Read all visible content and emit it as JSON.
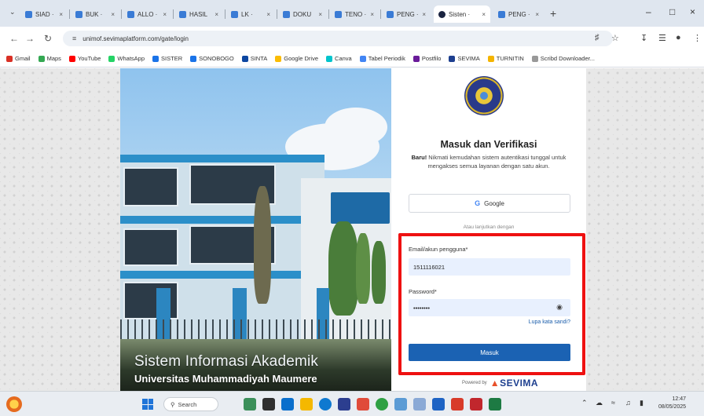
{
  "browser": {
    "tabs": [
      {
        "label": "SIAD ·",
        "active": false
      },
      {
        "label": "BUK ·",
        "active": false
      },
      {
        "label": "ALLO ·",
        "active": false
      },
      {
        "label": "HASIL",
        "active": false
      },
      {
        "label": "LK ·",
        "active": false
      },
      {
        "label": "DOKU",
        "active": false
      },
      {
        "label": "TENO ·",
        "active": false
      },
      {
        "label": "PENG ·",
        "active": false
      },
      {
        "label": "Sisten ·",
        "active": true
      },
      {
        "label": "PENG ·",
        "active": false
      }
    ],
    "url": "unimof.sevimaplatform.com/gate/login",
    "bookmarks": [
      {
        "label": "Gmail",
        "color": "#d93025"
      },
      {
        "label": "Maps",
        "color": "#34a853"
      },
      {
        "label": "YouTube",
        "color": "#ff0000"
      },
      {
        "label": "WhatsApp",
        "color": "#25d366"
      },
      {
        "label": "SISTER",
        "color": "#1a73e8"
      },
      {
        "label": "SONOBOGO",
        "color": "#1a73e8"
      },
      {
        "label": "SINTA",
        "color": "#0d47a1"
      },
      {
        "label": "Google Drive",
        "color": "#fbbc04"
      },
      {
        "label": "Canva",
        "color": "#00c4cc"
      },
      {
        "label": "Tabel Periodik",
        "color": "#4285f4"
      },
      {
        "label": "Postfilo",
        "color": "#6a1b9a"
      },
      {
        "label": "SEVIMA",
        "color": "#1d3f8f"
      },
      {
        "label": "TURNITIN",
        "color": "#f4b400"
      },
      {
        "label": "Scribd Downloader...",
        "color": "#999999"
      }
    ]
  },
  "hero": {
    "title_line1": "Sistem Informasi Akademik",
    "title_line2": "Universitas Muhammadiyah Maumere"
  },
  "login": {
    "title": "Masuk dan Verifikasi",
    "desc_bold": "Baru!",
    "desc_rest": " Nikmati kemudahan sistem autentikasi tunggal untuk mengakses semua layanan dengan satu akun.",
    "google_label": "Google",
    "alt_text": "Atau lanjutkan dengan",
    "email_label": "Email/akun pengguna*",
    "email_value": "1511116021",
    "password_label": "Password*",
    "password_value": "••••••••",
    "forgot_label": "Lupa kata sandi?",
    "submit_label": "Masuk",
    "powered_by": "Powered by",
    "brand": "SEVIMA"
  },
  "taskbar": {
    "search_placeholder": "Search",
    "time": "12:47",
    "date": "08/05/2025"
  },
  "colors": {
    "primary_button": "#1b62b3",
    "highlight_box": "#ee1111"
  }
}
